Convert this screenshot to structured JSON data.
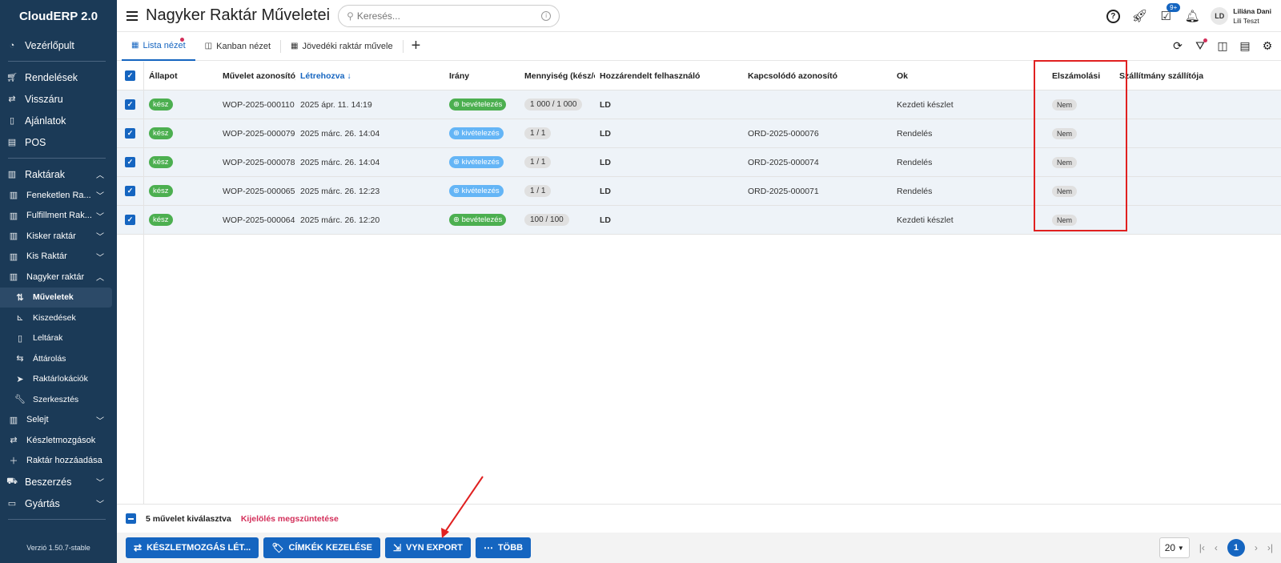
{
  "sidebar": {
    "brand": "CloudERP 2.0",
    "dashboard": "Vezérlőpult",
    "orders": "Rendelések",
    "returns": "Visszáru",
    "offers": "Ajánlatok",
    "pos": "POS",
    "warehouses": "Raktárak",
    "wh_items": [
      "Feneketlen Ra...",
      "Fulfillment Rak...",
      "Kisker raktár",
      "Kis Raktár",
      "Nagyker raktár"
    ],
    "sub_items": [
      "Műveletek",
      "Kiszedések",
      "Leltárak",
      "Áttárolás",
      "Raktárlokációk",
      "Szerkesztés"
    ],
    "selejt": "Selejt",
    "stock_moves": "Készletmozgások",
    "add_wh": "Raktár hozzáadása",
    "purchase": "Beszerzés",
    "production": "Gyártás",
    "version": "Verzió 1.50.7-stable"
  },
  "header": {
    "title": "Nagyker Raktár Műveletei",
    "search_placeholder": "Keresés...",
    "notif_badge": "9+",
    "user_initials": "LD",
    "user_name": "Liliána Dani",
    "user_company": "Lili Teszt"
  },
  "tabs": [
    "Lista nézet",
    "Kanban nézet",
    "Jövedéki raktár művele"
  ],
  "table": {
    "headers": [
      "Állapot",
      "Művelet azonosítója",
      "Létrehozva",
      "Irány",
      "Mennyiség (kész/össz)",
      "Hozzárendelt felhasználó",
      "Kapcsolódó azonosító",
      "Ok",
      "Elszámolási",
      "Szállítmány szállítója"
    ],
    "rows": [
      {
        "status": "kész",
        "id": "WOP-2025-000110",
        "created": "2025 ápr. 11. 14:19",
        "dir": "bevételezés",
        "qty": "1 000 / 1 000",
        "user": "LD",
        "ref": "",
        "reason": "Kezdeti készlet",
        "billing": "Nem"
      },
      {
        "status": "kész",
        "id": "WOP-2025-000079",
        "created": "2025 márc. 26. 14:04",
        "dir": "kivételezés",
        "qty": "1 / 1",
        "user": "LD",
        "ref": "ORD-2025-000076",
        "reason": "Rendelés",
        "billing": "Nem"
      },
      {
        "status": "kész",
        "id": "WOP-2025-000078",
        "created": "2025 márc. 26. 14:04",
        "dir": "kivételezés",
        "qty": "1 / 1",
        "user": "LD",
        "ref": "ORD-2025-000074",
        "reason": "Rendelés",
        "billing": "Nem"
      },
      {
        "status": "kész",
        "id": "WOP-2025-000065",
        "created": "2025 márc. 26. 12:23",
        "dir": "kivételezés",
        "qty": "1 / 1",
        "user": "LD",
        "ref": "ORD-2025-000071",
        "reason": "Rendelés",
        "billing": "Nem"
      },
      {
        "status": "kész",
        "id": "WOP-2025-000064",
        "created": "2025 márc. 26. 12:20",
        "dir": "bevételezés",
        "qty": "100 / 100",
        "user": "LD",
        "ref": "",
        "reason": "Kezdeti készlet",
        "billing": "Nem"
      }
    ]
  },
  "selection": {
    "count_text": "5 művelet kiválasztva",
    "clear_text": "Kijelölés megszüntetése"
  },
  "actions": {
    "stock_move": "KÉSZLETMOZGÁS LÉT...",
    "labels": "CÍMKÉK KEZELÉSE",
    "vyn_export": "VYN EXPORT",
    "more": "TÖBB"
  },
  "pager": {
    "page_size": "20",
    "current_page": "1"
  }
}
